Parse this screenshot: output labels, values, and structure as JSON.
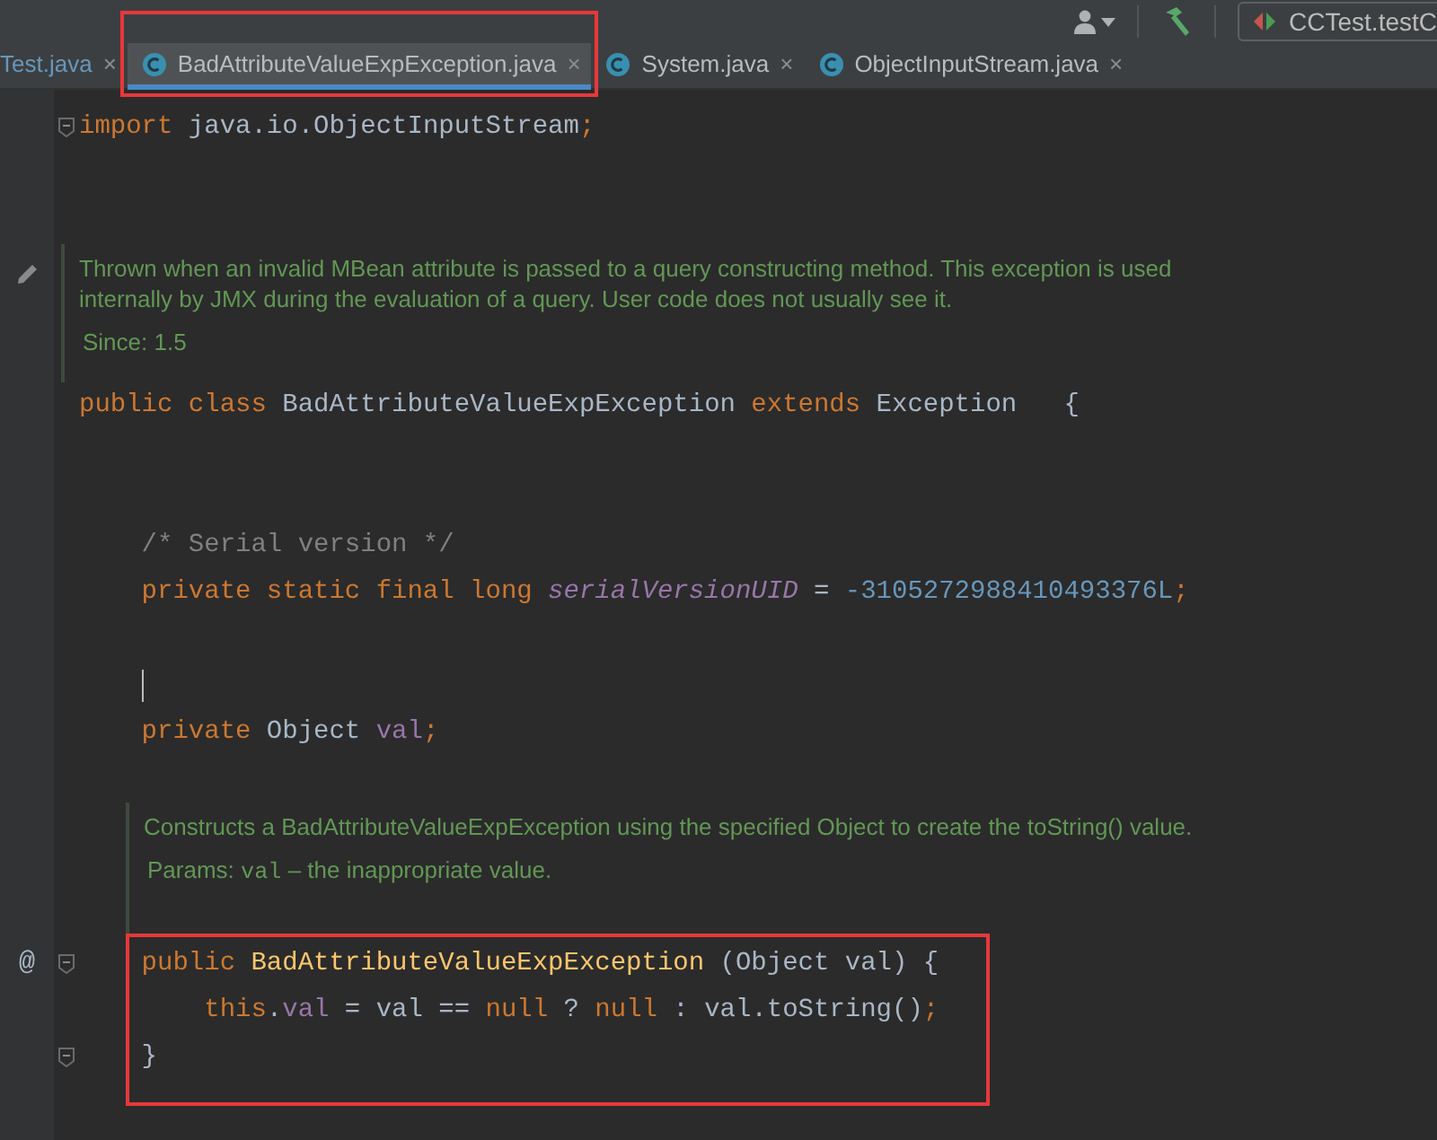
{
  "toolbar": {
    "run_configuration": "CCTest.testC"
  },
  "tabs": [
    {
      "label": "Test.java",
      "close": "×",
      "selected": false,
      "modified": true,
      "icon": false,
      "annotated": false
    },
    {
      "label": "BadAttributeValueExpException.java",
      "close": "×",
      "selected": true,
      "modified": false,
      "icon": true,
      "annotated": true
    },
    {
      "label": "System.java",
      "close": "×",
      "selected": false,
      "modified": false,
      "icon": true,
      "annotated": false
    },
    {
      "label": "ObjectInputStream.java",
      "close": "×",
      "selected": false,
      "modified": false,
      "icon": true,
      "annotated": false
    }
  ],
  "editor": {
    "lines": [
      {
        "kind": "code",
        "fold": true,
        "tokens": [
          {
            "kind": "keyword",
            "text": "import"
          },
          {
            "kind": "plain",
            "text": " java.io.ObjectInputStream"
          },
          {
            "kind": "keyword",
            "text": ";"
          }
        ]
      },
      {
        "kind": "blank"
      },
      {
        "kind": "blank"
      },
      {
        "kind": "doc",
        "edit_icon": true,
        "inside_class": false,
        "text": "Thrown when an invalid MBean attribute is passed to a query constructing method. This exception is used internally by JMX during the evaluation of a query. User code does not usually see it.",
        "tags": [
          {
            "label": "Since:",
            "text": "1.5"
          }
        ]
      },
      {
        "kind": "code",
        "tokens": [
          {
            "kind": "keyword",
            "text": "public class "
          },
          {
            "kind": "plain",
            "text": "BadAttributeValueExpException "
          },
          {
            "kind": "keyword",
            "text": "extends "
          },
          {
            "kind": "plain",
            "text": "Exception   {"
          }
        ]
      },
      {
        "kind": "blank"
      },
      {
        "kind": "blank"
      },
      {
        "kind": "code",
        "tokens": [
          {
            "kind": "comment",
            "text": "    /* Serial version */"
          }
        ]
      },
      {
        "kind": "code",
        "tokens": [
          {
            "kind": "keyword",
            "text": "    private static final long "
          },
          {
            "kind": "static-field",
            "text": "serialVersionUID"
          },
          {
            "kind": "plain",
            "text": " = "
          },
          {
            "kind": "number",
            "text": "-3105272988410493376L"
          },
          {
            "kind": "keyword",
            "text": ";"
          }
        ]
      },
      {
        "kind": "blank"
      },
      {
        "kind": "code",
        "cursor": true
      },
      {
        "kind": "code",
        "tokens": [
          {
            "kind": "keyword",
            "text": "    private "
          },
          {
            "kind": "plain",
            "text": "Object "
          },
          {
            "kind": "field",
            "text": "val"
          },
          {
            "kind": "keyword",
            "text": ";"
          }
        ]
      },
      {
        "kind": "blank"
      },
      {
        "kind": "doc",
        "edit_icon": false,
        "inside_class": true,
        "text": "Constructs a BadAttributeValueExpException using the specified Object to create the toString() value.",
        "tags": [
          {
            "label": "Params:",
            "code": "val",
            "text": "– the inappropriate value."
          }
        ]
      },
      {
        "kind": "annotated",
        "lines": [
          {
            "kind": "code",
            "gutter_mark": "@",
            "fold": true,
            "tokens": [
              {
                "kind": "keyword",
                "text": "    public "
              },
              {
                "kind": "method",
                "text": "BadAttributeValueExpException"
              },
              {
                "kind": "plain",
                "text": " (Object val) {"
              }
            ]
          },
          {
            "kind": "code",
            "tokens": [
              {
                "kind": "keyword",
                "text": "        this"
              },
              {
                "kind": "plain",
                "text": "."
              },
              {
                "kind": "field",
                "text": "val"
              },
              {
                "kind": "plain",
                "text": " = val == "
              },
              {
                "kind": "keyword",
                "text": "null"
              },
              {
                "kind": "plain",
                "text": " ? "
              },
              {
                "kind": "keyword",
                "text": "null"
              },
              {
                "kind": "plain",
                "text": " : val.toString()"
              },
              {
                "kind": "keyword",
                "text": ";"
              }
            ]
          },
          {
            "kind": "code",
            "fold": true,
            "tokens": [
              {
                "kind": "plain",
                "text": "    }"
              }
            ]
          }
        ]
      }
    ]
  }
}
